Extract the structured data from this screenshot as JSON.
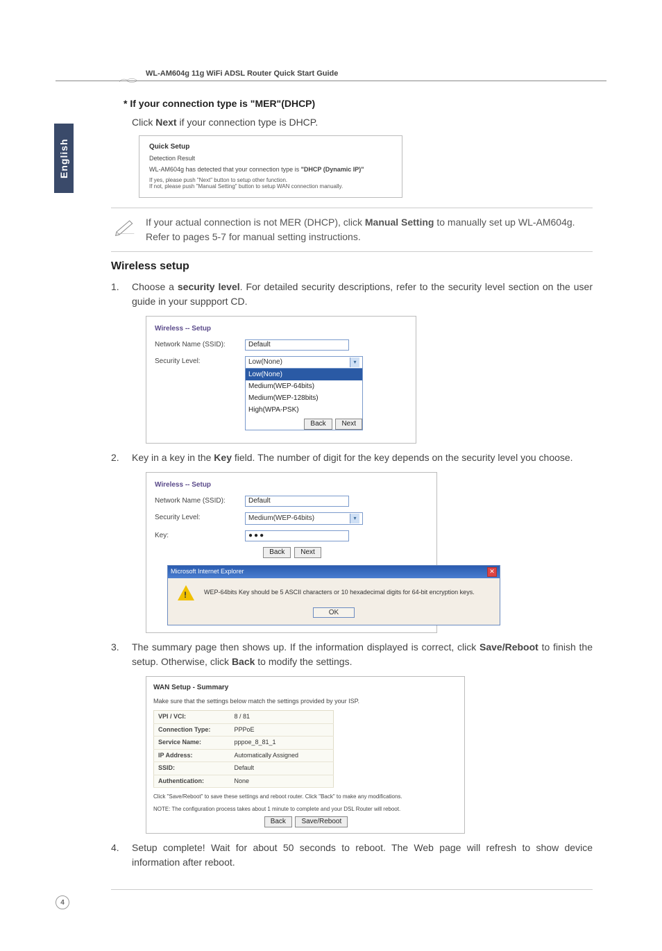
{
  "header": {
    "title": "WL-AM604g 11g WiFi ADSL Router Quick Start Guide"
  },
  "side_tab": "English",
  "mer": {
    "heading": "* If your connection type is \"MER\"(DHCP)",
    "click_next_prefix": "Click ",
    "click_next_bold": "Next",
    "click_next_suffix": " if your connection type is DHCP."
  },
  "quicksetup": {
    "title": "Quick Setup",
    "subtitle": "Detection Result",
    "detected_pre": "WL-AM604g has detected that your connection type is ",
    "detected_hl": "\"DHCP (Dynamic IP)\"",
    "line1": "If yes, please push \"Next\" button to setup other function.",
    "line2": "If not, please push \"Manual Setting\" button to setup WAN connection manually."
  },
  "note": {
    "pre": "If your actual connection is not MER (DHCP), click ",
    "bold1": "Manual Setting",
    "mid": " to manually set up WL-AM604g. Refer to pages 5-7 for manual setting instructions."
  },
  "wireless_section_title": "Wireless setup",
  "steps": {
    "s1_pre": "Choose a ",
    "s1_bold": "security level",
    "s1_post": ".  For detailed security descriptions, refer to the security level  section on the user guide in your suppport CD.",
    "s2_pre": "Key in a key in the ",
    "s2_bold": "Key",
    "s2_post": " field. The number of digit for the key depends on the security level you choose.",
    "s3_pre": "The summary page then shows up. If the information displayed is correct, click ",
    "s3_bold1": "Save/Reboot",
    "s3_mid": " to finish the setup. Otherwise, click ",
    "s3_bold2": "Back",
    "s3_post": " to modify the settings.",
    "s4": "Setup complete! Wait for about 50 seconds to reboot. The Web page will refresh to show device information after reboot."
  },
  "wl1": {
    "title": "Wireless -- Setup",
    "ssid_label": "Network Name (SSID):",
    "ssid_value": "Default",
    "sec_label": "Security Level:",
    "sel_value": "Low(None)",
    "options": [
      "Low(None)",
      "Medium(WEP-64bits)",
      "Medium(WEP-128bits)",
      "High(WPA-PSK)"
    ],
    "back": "Back",
    "next": "Next"
  },
  "wl2": {
    "title": "Wireless -- Setup",
    "ssid_label": "Network Name (SSID):",
    "ssid_value": "Default",
    "sec_label": "Security Level:",
    "sec_value": "Medium(WEP-64bits)",
    "key_label": "Key:",
    "key_value": "●●●",
    "back": "Back",
    "next": "Next"
  },
  "ie": {
    "title": "Microsoft Internet Explorer",
    "msg": "WEP-64bits Key should be 5 ASCII characters or 10 hexadecimal digits for 64-bit encryption keys.",
    "ok": "OK"
  },
  "summary": {
    "title": "WAN Setup - Summary",
    "intro": "Make sure that the settings below match the settings provided by your ISP.",
    "rows": [
      {
        "k": "VPI / VCI:",
        "v": "8 / 81"
      },
      {
        "k": "Connection Type:",
        "v": "PPPoE"
      },
      {
        "k": "Service Name:",
        "v": "pppoe_8_81_1"
      },
      {
        "k": "IP Address:",
        "v": "Automatically Assigned"
      },
      {
        "k": "SSID:",
        "v": "Default"
      },
      {
        "k": "Authentication:",
        "v": "None"
      }
    ],
    "note1": "Click \"Save/Reboot\" to save these settings and reboot router. Click \"Back\" to make any modifications.",
    "note2": "NOTE: The configuration process takes about 1 minute to complete and your DSL Router will reboot.",
    "back": "Back",
    "save": "Save/Reboot"
  },
  "page_number": "4"
}
